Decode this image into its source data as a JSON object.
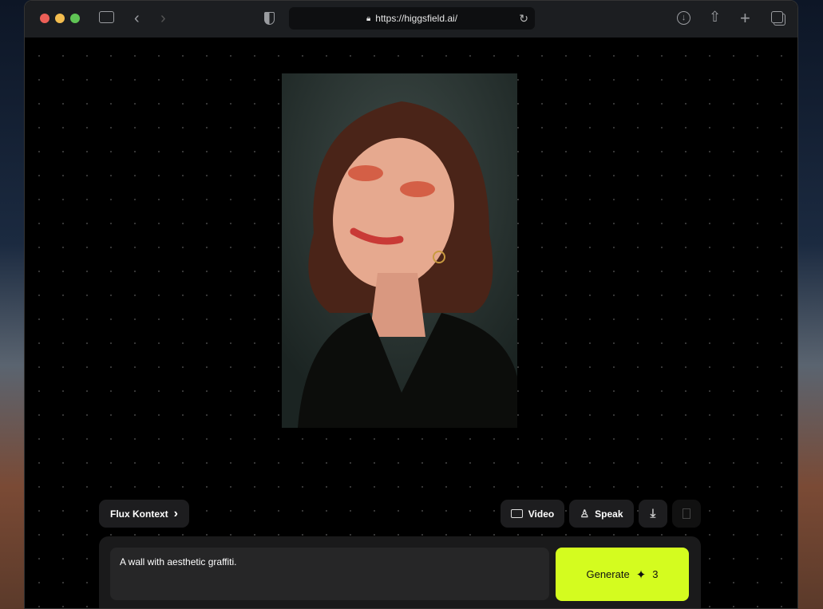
{
  "browser": {
    "url": "https://higgsfield.ai/"
  },
  "toolbar": {
    "model_label": "Flux Kontext",
    "video_label": "Video",
    "speak_label": "Speak"
  },
  "prompt": {
    "value": "A wall with aesthetic graffiti."
  },
  "generate": {
    "label": "Generate",
    "credits": "3"
  },
  "colors": {
    "accent": "#d4fc1f"
  }
}
